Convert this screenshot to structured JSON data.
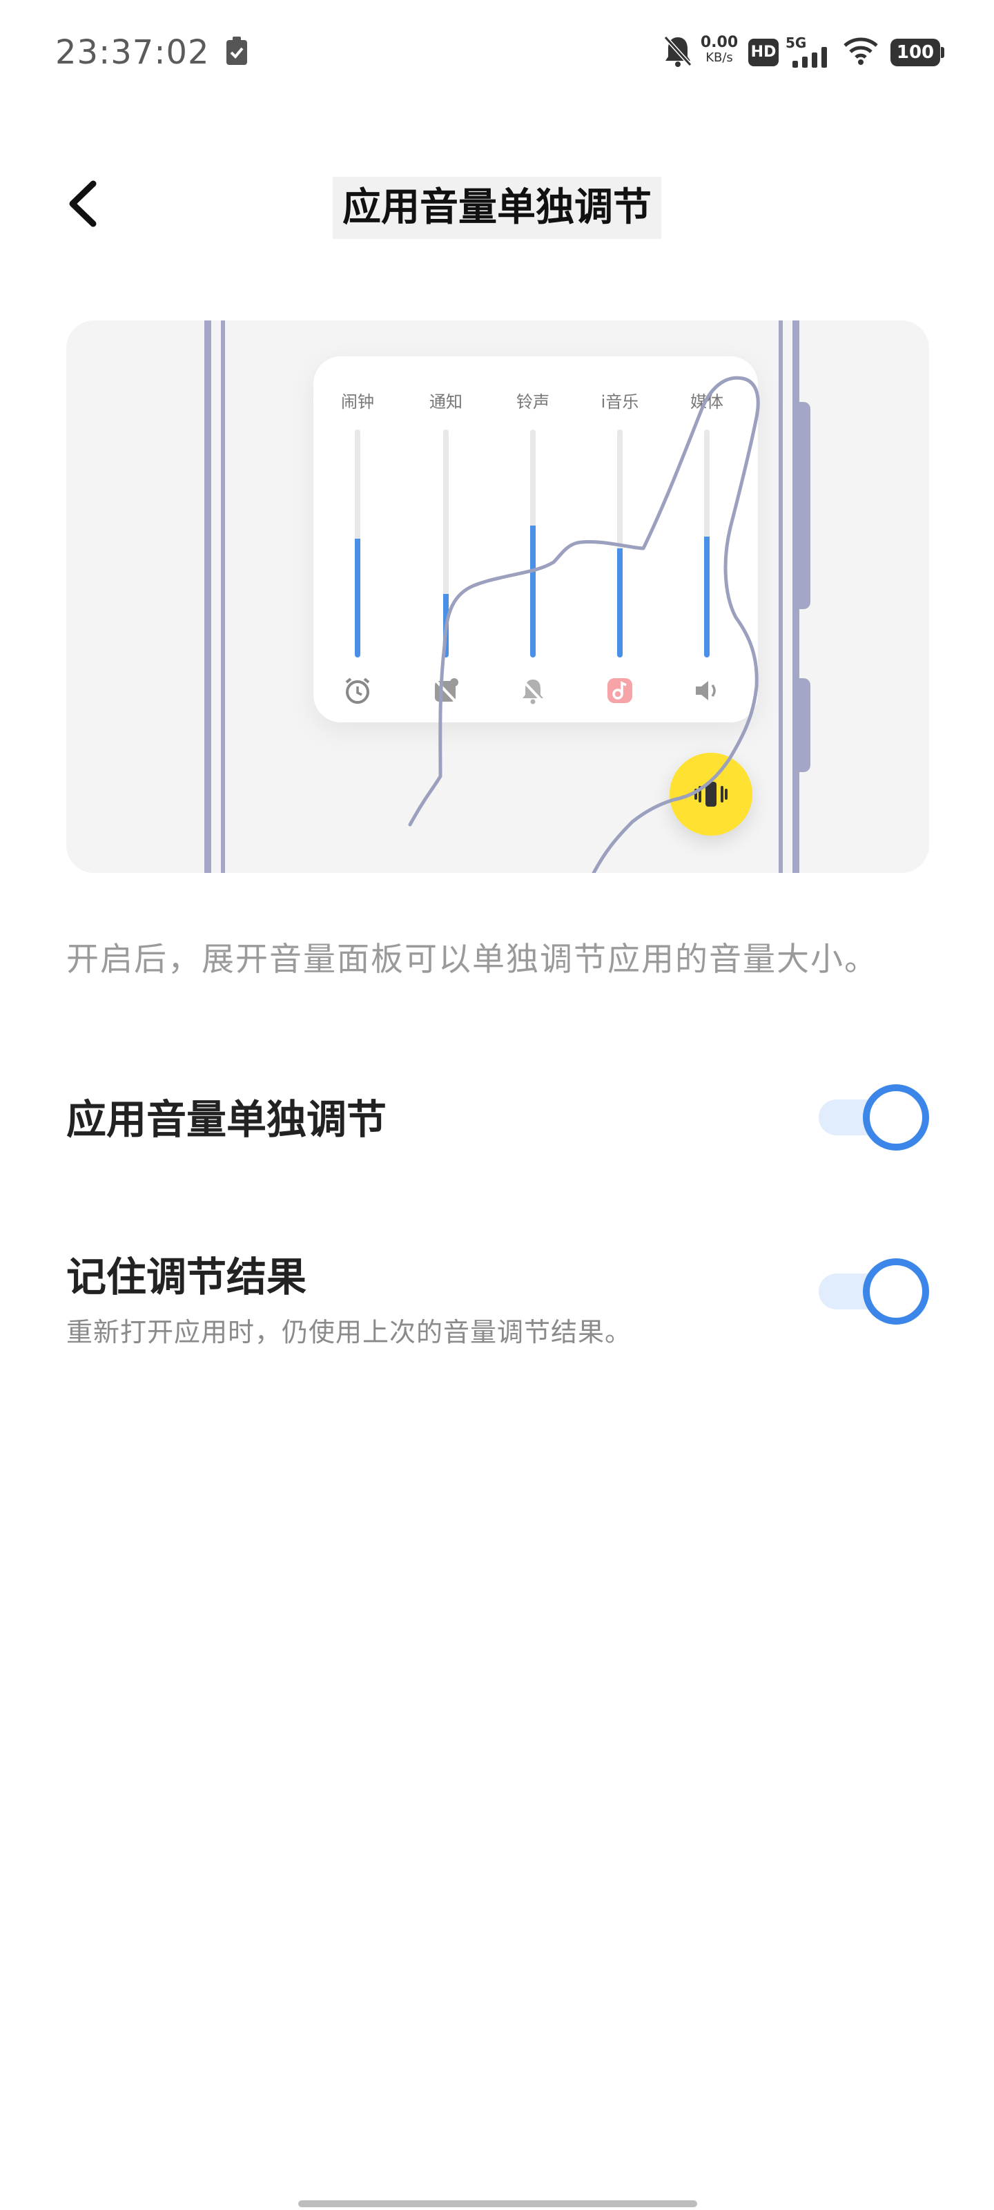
{
  "status_bar": {
    "time": "23:37:02",
    "net_speed_value": "0.00",
    "net_speed_unit": "KB/s",
    "hd_label": "HD",
    "signal_label": "5G",
    "battery": "100",
    "icons": [
      "battery-saver-icon",
      "mute-bell-icon",
      "hd-icon",
      "signal-5g-icon",
      "wifi-icon",
      "battery-icon"
    ]
  },
  "header": {
    "title": "应用音量单独调节",
    "back_icon": "chevron-left-icon"
  },
  "illustration": {
    "channels": [
      {
        "label": "闹钟",
        "level": 0.52,
        "icon": "alarm-icon"
      },
      {
        "label": "通知",
        "level": 0.28,
        "icon": "notification-muted-icon"
      },
      {
        "label": "铃声",
        "level": 0.58,
        "icon": "bell-muted-icon"
      },
      {
        "label": "i音乐",
        "level": 0.48,
        "icon": "music-app-icon"
      },
      {
        "label": "媒体",
        "level": 0.53,
        "icon": "speaker-icon"
      }
    ],
    "fab_icon": "vibrate-icon",
    "accent": "#4a8fe8",
    "fab_color": "#ffe132"
  },
  "description": "开启后，展开音量面板可以单独调节应用的音量大小。",
  "settings": [
    {
      "title": "应用音量单独调节",
      "subtitle": "",
      "enabled": true
    },
    {
      "title": "记住调节结果",
      "subtitle": "重新打开应用时，仍使用上次的音量调节结果。",
      "enabled": true
    }
  ],
  "colors": {
    "toggle_on": "#3b86e8",
    "toggle_track": "#e1edfc"
  }
}
